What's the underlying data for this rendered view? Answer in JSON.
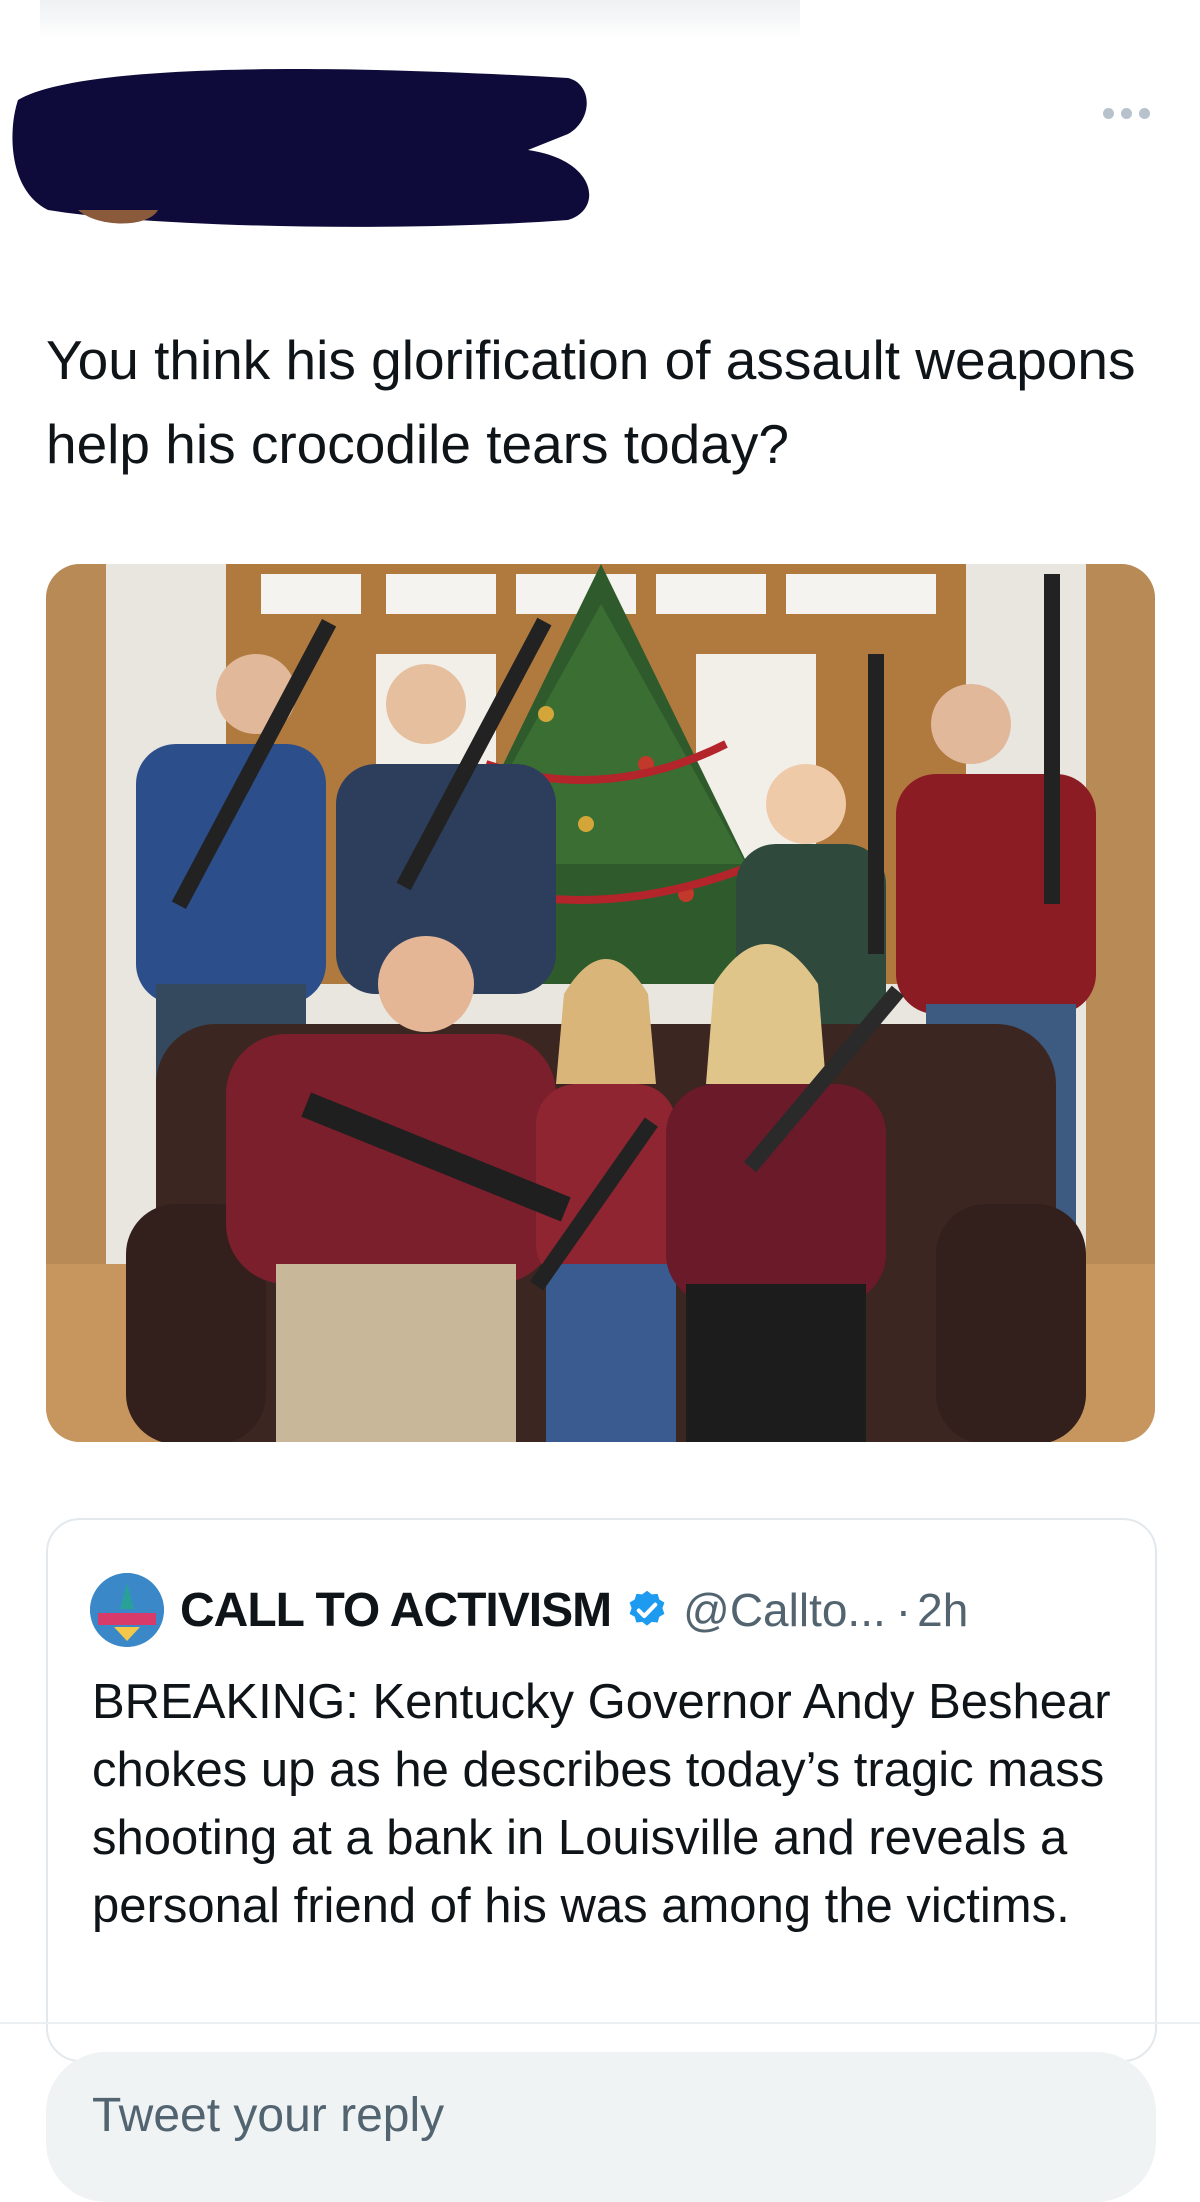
{
  "tweet": {
    "text": "You think his glorification of assault weapons help his crocodile tears today?"
  },
  "quoted_tweet": {
    "name": "CALL TO ACTIVISM",
    "handle": "@Callto...",
    "separator": "·",
    "time": "2h",
    "text": "BREAKING: Kentucky Governor Andy Beshear chokes up as he describes today’s tragic mass shooting at a bank in Louisville and reveals a personal friend of his was among the victims."
  },
  "reply_box": {
    "placeholder": "Tweet your reply"
  },
  "colors": {
    "verified": "#1d9bf0",
    "redaction": "#0e0b3a",
    "secondary_text": "#536471"
  }
}
